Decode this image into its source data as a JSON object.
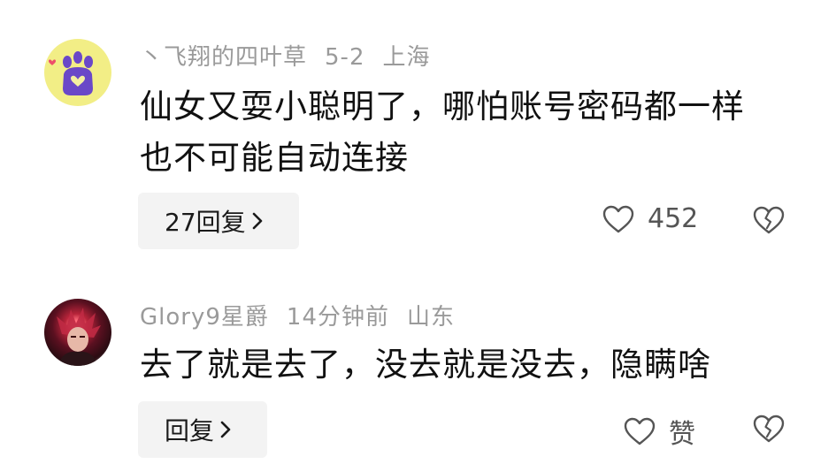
{
  "comments": [
    {
      "username": "丶飞翔的四叶草",
      "date": "5-2",
      "location": "上海",
      "text": "仙女又耍小聪明了，哪怕账号密码都一样 也不可能自动连接",
      "reply_label": "27回复",
      "like_label": "452",
      "avatar_icon": "cat-paw-icon"
    },
    {
      "username": "Glory9星爵",
      "date": "14分钟前",
      "location": "山东",
      "text": "去了就是去了，没去就是没去，隐瞒啥",
      "reply_label": "回复",
      "like_label": "赞",
      "avatar_icon": "anime-character-avatar"
    }
  ],
  "colors": {
    "meta_text": "#9a9a9a",
    "reply_bg": "#f3f3f3",
    "avatar_1_bg": "#f2ee86",
    "paw": "#6a48c8",
    "paw_heart": "#ee4d6a"
  }
}
